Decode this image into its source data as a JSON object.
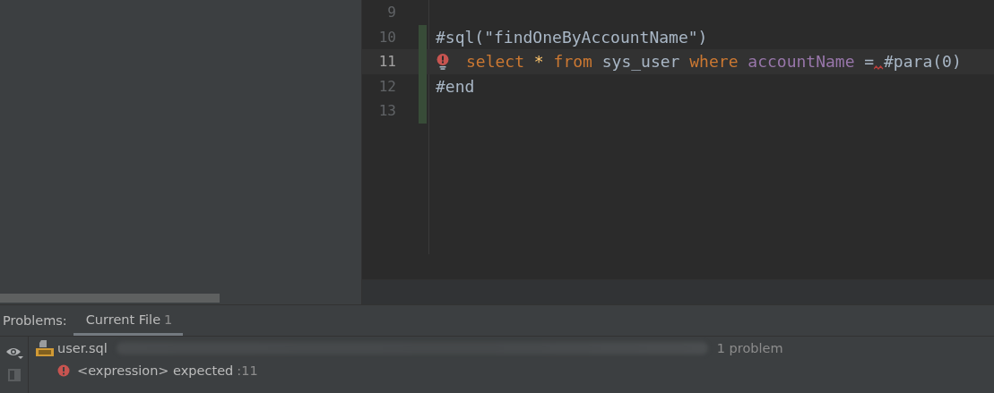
{
  "editor": {
    "lines": [
      {
        "number": "9",
        "current": false,
        "error": false,
        "changed": false
      },
      {
        "number": "10",
        "current": false,
        "error": false,
        "changed": true,
        "tokens": [
          {
            "kind": "directive",
            "text": "#sql(\"findOneByAccountName\")"
          }
        ]
      },
      {
        "number": "11",
        "current": true,
        "error": true,
        "changed": true,
        "tokens": [
          {
            "kind": "keyword",
            "text": "select "
          },
          {
            "kind": "star",
            "text": "* "
          },
          {
            "kind": "keyword",
            "text": "from "
          },
          {
            "kind": "plain",
            "text": "sys_user "
          },
          {
            "kind": "keyword",
            "text": "where "
          },
          {
            "kind": "column",
            "text": "accountName "
          },
          {
            "kind": "plain",
            "text": "=",
            "squiggle_after": true
          },
          {
            "kind": "directive",
            "text": "#para(0)"
          }
        ]
      },
      {
        "number": "12",
        "current": false,
        "error": false,
        "changed": true,
        "tokens": [
          {
            "kind": "directive",
            "text": "#end"
          }
        ]
      },
      {
        "number": "13",
        "current": false,
        "error": false,
        "changed": true
      }
    ]
  },
  "problems": {
    "label": "Problems:",
    "tabs": [
      {
        "label": "Current File",
        "count": "1",
        "selected": true
      }
    ],
    "file": {
      "name": "user.sql",
      "summary": "1 problem"
    },
    "items": [
      {
        "message": "<expression> expected",
        "location": ":11"
      }
    ]
  }
}
